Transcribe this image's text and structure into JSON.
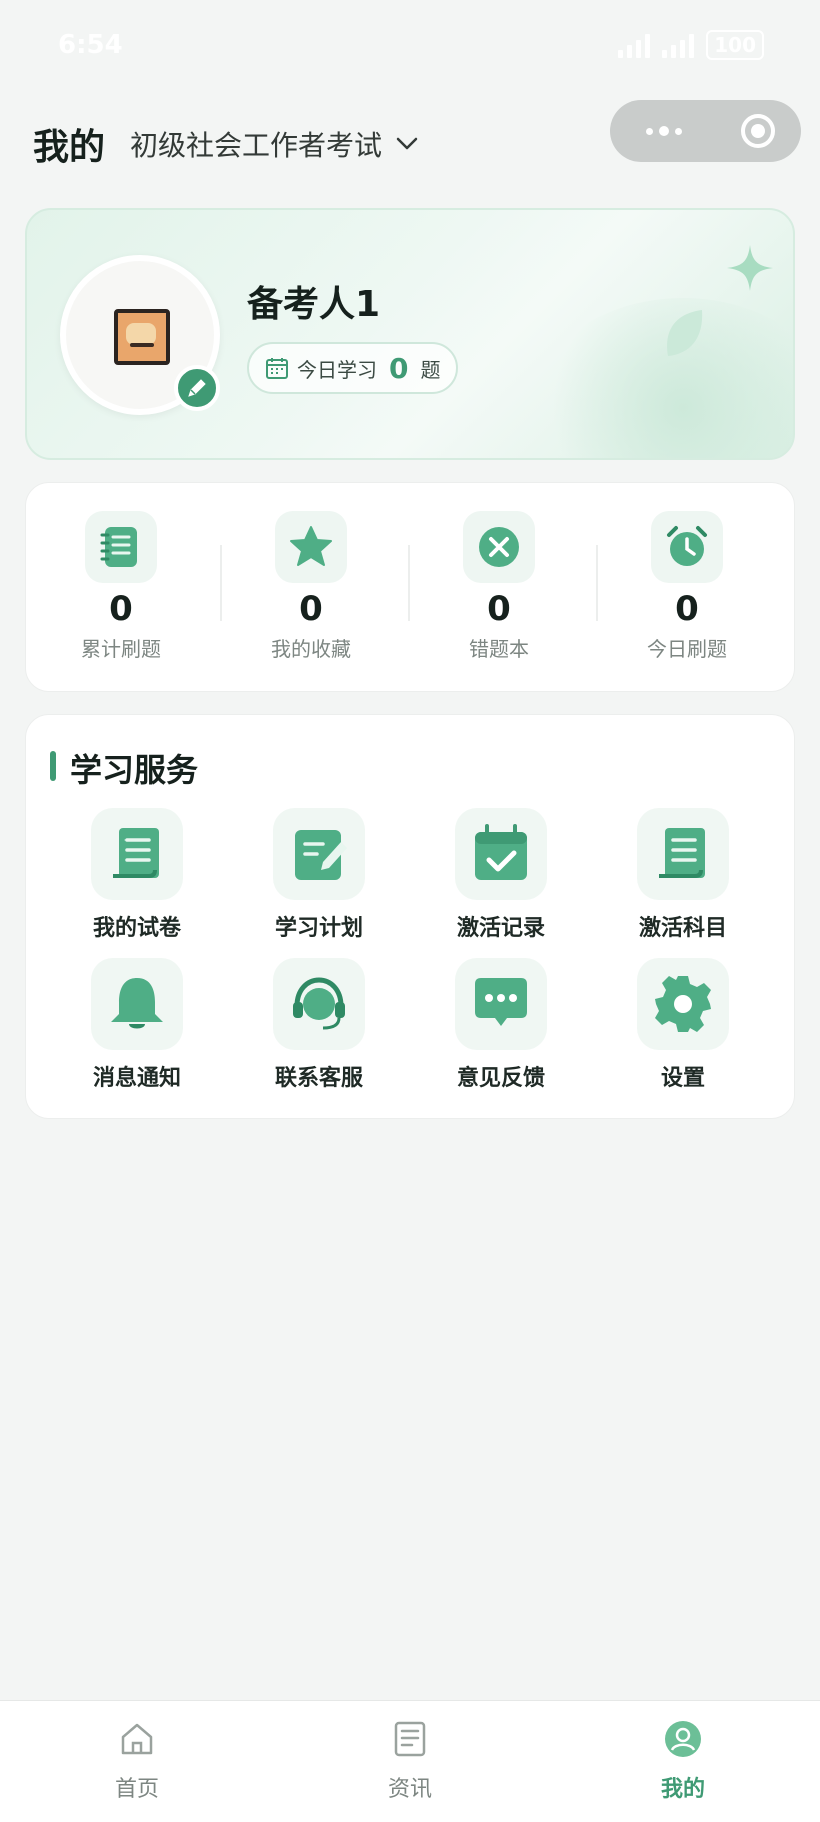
{
  "status_bar": {
    "time": "6:54",
    "battery": "100"
  },
  "header": {
    "title": "我的",
    "exam_selector": "初级社会工作者考试"
  },
  "profile": {
    "name": "备考人1",
    "today_prefix": "今日学习",
    "today_count": "0",
    "today_suffix": "题"
  },
  "stats": [
    {
      "value": "0",
      "label": "累计刷题",
      "icon": "notebook-icon"
    },
    {
      "value": "0",
      "label": "我的收藏",
      "icon": "star-icon"
    },
    {
      "value": "0",
      "label": "错题本",
      "icon": "x-circle-icon"
    },
    {
      "value": "0",
      "label": "今日刷题",
      "icon": "alarm-clock-icon"
    }
  ],
  "services": {
    "title": "学习服务",
    "items": [
      {
        "label": "我的试卷",
        "icon": "paper-scroll-icon"
      },
      {
        "label": "学习计划",
        "icon": "plan-edit-icon"
      },
      {
        "label": "激活记录",
        "icon": "calendar-check-icon"
      },
      {
        "label": "激活科目",
        "icon": "subject-scroll-icon"
      },
      {
        "label": "消息通知",
        "icon": "bell-icon"
      },
      {
        "label": "联系客服",
        "icon": "headset-icon"
      },
      {
        "label": "意见反馈",
        "icon": "chat-bubble-icon"
      },
      {
        "label": "设置",
        "icon": "gear-icon"
      }
    ]
  },
  "tabs": [
    {
      "label": "首页",
      "icon": "home-icon"
    },
    {
      "label": "资讯",
      "icon": "news-icon"
    },
    {
      "label": "我的",
      "icon": "profile-icon",
      "active": true
    }
  ],
  "colors": {
    "accent": "#3f9a74",
    "background": "#f3f5f4"
  }
}
